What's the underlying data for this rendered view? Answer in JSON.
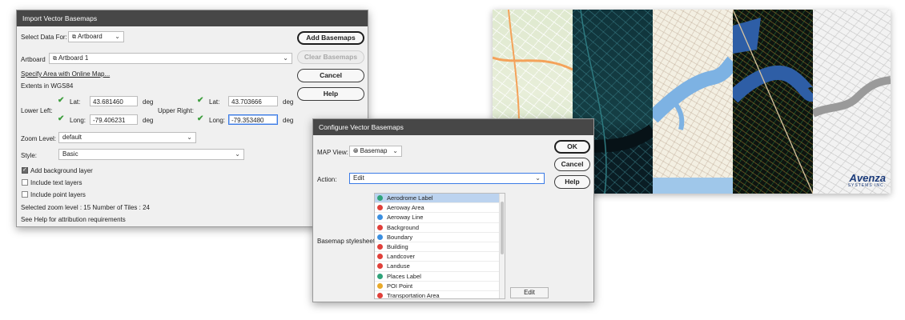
{
  "import_dialog": {
    "title": "Import Vector Basemaps",
    "select_data_label": "Select Data For:",
    "select_data_value": "Artboard",
    "artboard_label": "Artboard",
    "artboard_value": "Artboard 1",
    "specify_area_link": "Specify Area with Online Map...",
    "extents_label": "Extents in WGS84",
    "lower_left_label": "Lower Left:",
    "upper_right_label": "Upper Right:",
    "lat_label": "Lat:",
    "long_label": "Long:",
    "deg_label": "deg",
    "ll_lat": "43.681460",
    "ll_long": "-79.406231",
    "ur_lat": "43.703666",
    "ur_long": "-79.353480",
    "zoom_label": "Zoom Level:",
    "zoom_value": "default",
    "style_label": "Style:",
    "style_value": "Basic",
    "add_background_label": "Add background layer",
    "include_text_label": "Include text layers",
    "include_point_label": "Include point layers",
    "zoom_info": "Selected zoom level : 15  Number of Tiles : 24",
    "help_info": "See Help for attribution requirements",
    "add_basemaps_btn": "Add Basemaps",
    "clear_basemaps_btn": "Clear Basemaps",
    "cancel_btn": "Cancel",
    "help_btn": "Help"
  },
  "configure_dialog": {
    "title": "Configure Vector Basemaps",
    "map_view_label": "MAP View:",
    "map_view_value": "Basemap",
    "action_label": "Action:",
    "action_value": "Edit",
    "stylesheet_label": "Basemap stylesheet:",
    "ok_btn": "OK",
    "cancel_btn": "Cancel",
    "help_btn": "Help",
    "edit_btn": "Edit",
    "layers": [
      {
        "label": "Aerodrome Label",
        "color": "#2fa37a"
      },
      {
        "label": "Aeroway Area",
        "color": "#e0403a"
      },
      {
        "label": "Aeroway Line",
        "color": "#3a8fe0"
      },
      {
        "label": "Background",
        "color": "#e0403a"
      },
      {
        "label": "Boundary",
        "color": "#3a8fe0"
      },
      {
        "label": "Building",
        "color": "#e0403a"
      },
      {
        "label": "Landcover",
        "color": "#e0403a"
      },
      {
        "label": "Landuse",
        "color": "#e0403a"
      },
      {
        "label": "Places Label",
        "color": "#2fa37a"
      },
      {
        "label": "POI Point",
        "color": "#e8a92a"
      },
      {
        "label": "Transportation Area",
        "color": "#e0403a"
      }
    ]
  },
  "logo": {
    "name": "Avenza",
    "sub": "SYSTEMS INC."
  }
}
